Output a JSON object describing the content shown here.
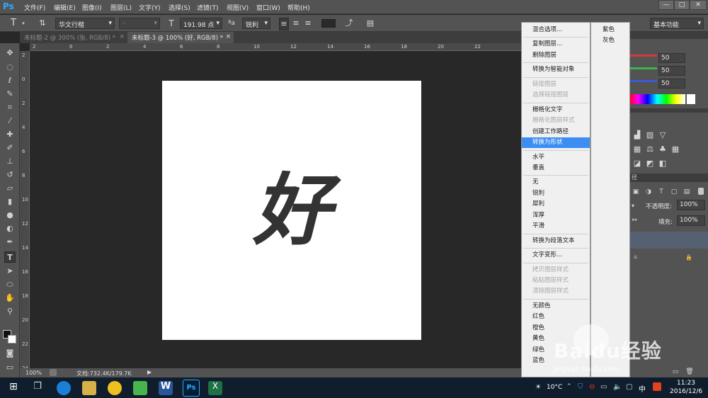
{
  "app": {
    "logo": "Ps"
  },
  "menu": [
    "文件(F)",
    "编辑(E)",
    "图像(I)",
    "图层(L)",
    "文字(Y)",
    "选择(S)",
    "滤镜(T)",
    "视图(V)",
    "窗口(W)",
    "帮助(H)"
  ],
  "window_buttons": [
    "—",
    "□",
    "✕"
  ],
  "options": {
    "font_family": "华文行楷",
    "font_style": "-",
    "font_size": "191.98 点",
    "aa_label": "ªa",
    "antialias": "锐利",
    "workspace": "基本功能"
  },
  "tabs": [
    {
      "label": "未标题-2 @ 300% (张, RGB/8) *",
      "active": false
    },
    {
      "label": "未标题-3 @ 100% (好, RGB/8) *",
      "active": true
    }
  ],
  "ruler_h": [
    "2",
    "0",
    "2",
    "4",
    "6",
    "8",
    "10",
    "12",
    "14",
    "16",
    "18",
    "20",
    "22"
  ],
  "ruler_v": [
    "2",
    "0",
    "2",
    "4",
    "6",
    "8",
    "10",
    "12",
    "14",
    "16",
    "18",
    "20",
    "22",
    "24"
  ],
  "canvas_text": "好",
  "status": {
    "zoom": "100%",
    "doc": "文档:732.4K/179.7K"
  },
  "context_menu": [
    {
      "label": "混合选项...",
      "state": "normal"
    },
    {
      "sep": true
    },
    {
      "label": "复制图层...",
      "state": "normal"
    },
    {
      "label": "删除图层",
      "state": "normal"
    },
    {
      "sep": true
    },
    {
      "label": "转换为智能对象",
      "state": "normal"
    },
    {
      "sep": true
    },
    {
      "label": "链接图层",
      "state": "disabled"
    },
    {
      "label": "选择链接图层",
      "state": "disabled"
    },
    {
      "sep": true
    },
    {
      "label": "栅格化文字",
      "state": "normal"
    },
    {
      "label": "栅格化图层样式",
      "state": "disabled"
    },
    {
      "label": "创建工作路径",
      "state": "normal"
    },
    {
      "label": "转换为形状",
      "state": "highlight"
    },
    {
      "sep": true
    },
    {
      "label": "水平",
      "state": "normal"
    },
    {
      "label": "垂直",
      "state": "normal"
    },
    {
      "sep": true
    },
    {
      "label": "无",
      "state": "normal"
    },
    {
      "label": "锐利",
      "state": "normal"
    },
    {
      "label": "犀利",
      "state": "normal"
    },
    {
      "label": "浑厚",
      "state": "normal"
    },
    {
      "label": "平滑",
      "state": "normal"
    },
    {
      "sep": true
    },
    {
      "label": "转换为段落文本",
      "state": "normal"
    },
    {
      "sep": true
    },
    {
      "label": "文字变形...",
      "state": "normal"
    },
    {
      "sep": true
    },
    {
      "label": "拷贝图层样式",
      "state": "disabled"
    },
    {
      "label": "粘贴图层样式",
      "state": "disabled"
    },
    {
      "label": "清除图层样式",
      "state": "disabled"
    },
    {
      "sep": true
    },
    {
      "label": "无颜色",
      "state": "normal"
    },
    {
      "label": "红色",
      "state": "normal"
    },
    {
      "label": "橙色",
      "state": "normal"
    },
    {
      "label": "黄色",
      "state": "normal"
    },
    {
      "label": "绿色",
      "state": "normal"
    },
    {
      "label": "蓝色",
      "state": "normal"
    }
  ],
  "submenu": [
    "紫色",
    "灰色"
  ],
  "right_panel": {
    "color_values": [
      "50",
      "50",
      "50"
    ],
    "opacity_label": "不透明度:",
    "opacity_value": "100%",
    "fill_label": "填充:",
    "fill_value": "100%",
    "paths_label": "径"
  },
  "taskbar": {
    "weather": "10°C",
    "ime": "中",
    "time": "11:23",
    "date": "2016/12/6"
  },
  "watermark": {
    "brand": "Baidu经验",
    "url": "jingyan.baidu.com"
  },
  "colors": {
    "accent": "#3c8ef3",
    "ps_blue": "#31a8ff",
    "panel": "#535353"
  }
}
